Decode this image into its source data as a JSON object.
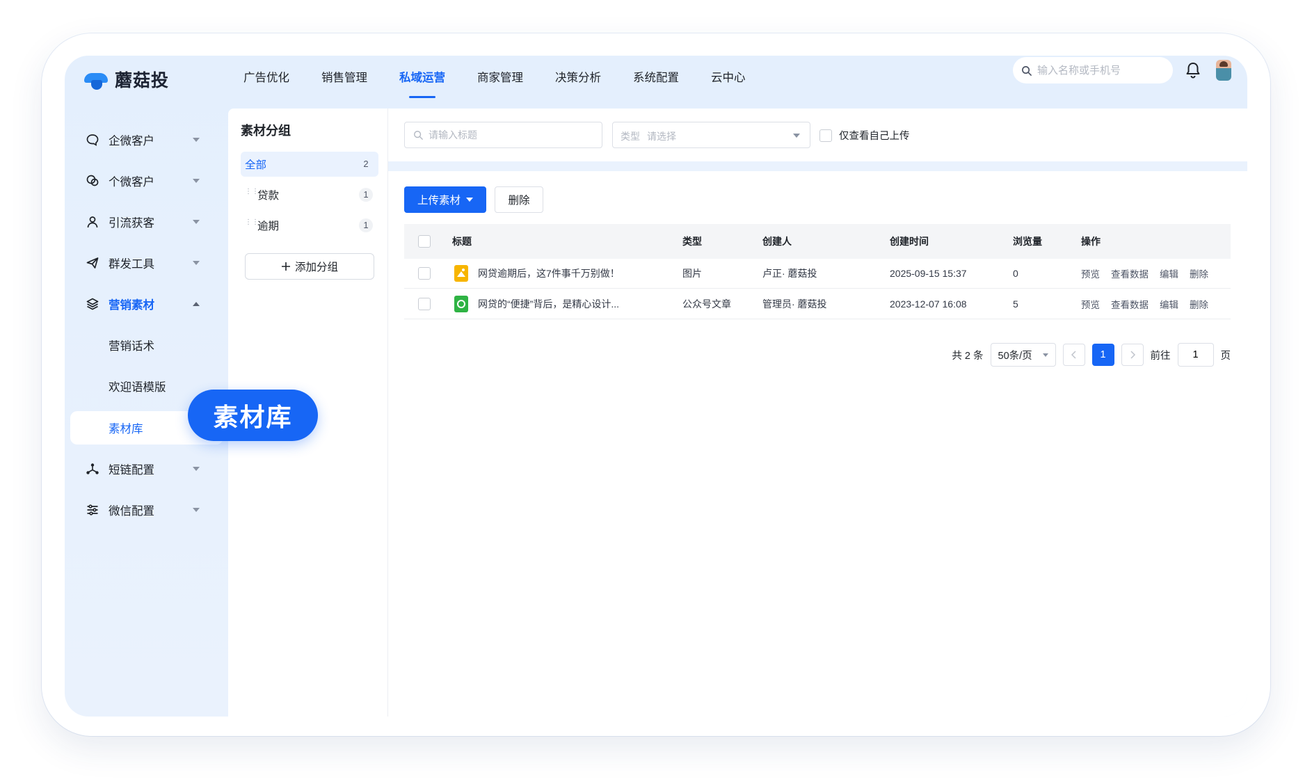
{
  "app": {
    "brand": "蘑菇投"
  },
  "nav": {
    "items": [
      "广告优化",
      "销售管理",
      "私域运营",
      "商家管理",
      "决策分析",
      "系统配置",
      "云中心"
    ],
    "active_index": 2
  },
  "header": {
    "search_placeholder": "输入名称或手机号"
  },
  "sidebar": {
    "items": [
      {
        "label": "企微客户",
        "icon": "chat-bubble-icon"
      },
      {
        "label": "个微客户",
        "icon": "double-chat-icon"
      },
      {
        "label": "引流获客",
        "icon": "user-icon"
      },
      {
        "label": "群发工具",
        "icon": "paper-plane-icon"
      },
      {
        "label": "营销素材",
        "icon": "layers-icon"
      },
      {
        "label": "营销话术"
      },
      {
        "label": "欢迎语模版"
      },
      {
        "label": "素材库"
      },
      {
        "label": "短链配置",
        "icon": "share-nodes-icon"
      },
      {
        "label": "微信配置",
        "icon": "sliders-icon"
      }
    ],
    "tooltip": "素材库"
  },
  "groups": {
    "title": "素材分组",
    "items": [
      {
        "label": "全部",
        "count": "2"
      },
      {
        "label": "贷款",
        "count": "1"
      },
      {
        "label": "逾期",
        "count": "1"
      }
    ],
    "add_label": "添加分组"
  },
  "filters": {
    "title_placeholder": "请输入标题",
    "type_label": "类型",
    "type_placeholder": "请选择",
    "only_mine_label": "仅查看自己上传"
  },
  "toolbar": {
    "upload_label": "上传素材",
    "delete_label": "删除"
  },
  "table": {
    "columns": [
      "标题",
      "类型",
      "创建人",
      "创建时间",
      "浏览量",
      "操作"
    ],
    "rows": [
      {
        "title": "网贷逾期后，这7件事千万别做！",
        "type": "图片",
        "creator": "卢正· 蘑菇投",
        "created": "2025-09-15 15:37",
        "views": "0",
        "file_icon": "image-file-icon"
      },
      {
        "title": "网贷的“便捷”背后，是精心设计...",
        "type": "公众号文章",
        "creator": "管理员· 蘑菇投",
        "created": "2023-12-07 16:08",
        "views": "5",
        "file_icon": "wechat-article-icon"
      }
    ],
    "ops": [
      "预览",
      "查看数据",
      "编辑",
      "删除"
    ]
  },
  "pagination": {
    "total_text": "共 2 条",
    "page_size": "50条/页",
    "current_page": "1",
    "goto_label": "前往",
    "goto_value": "1",
    "page_suffix": "页"
  },
  "colors": {
    "accent": "#1766f5",
    "app_bg": "#e4effd"
  }
}
